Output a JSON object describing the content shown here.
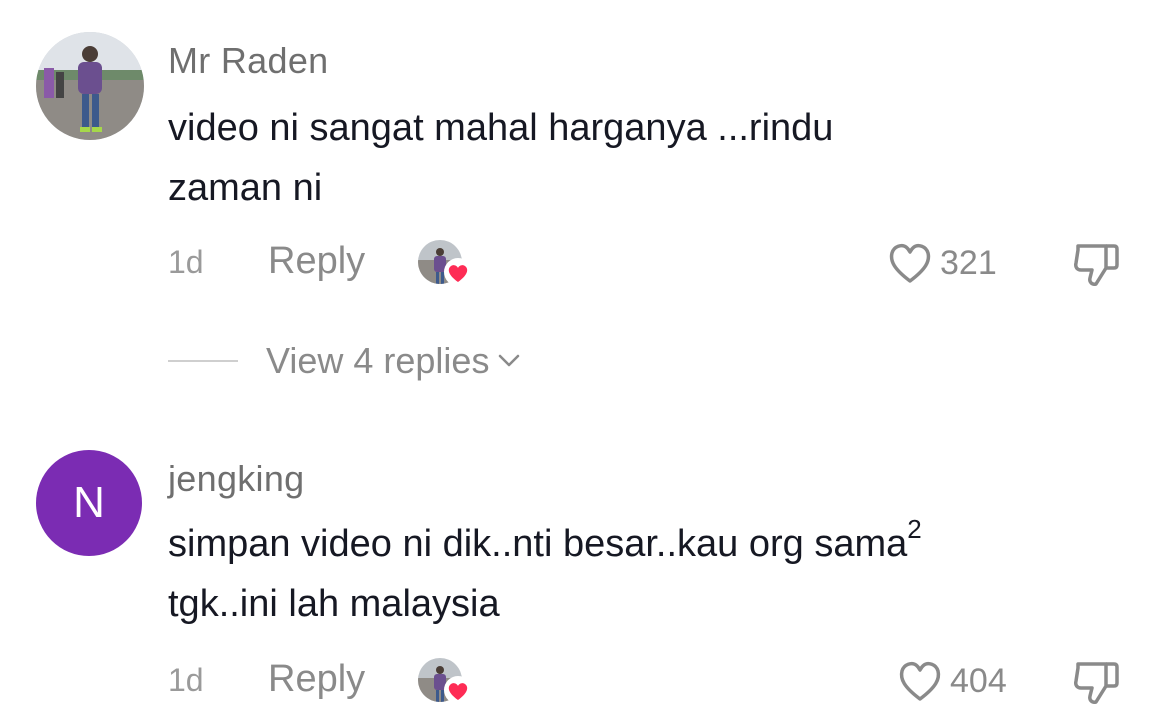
{
  "comments": [
    {
      "username": "Mr Raden",
      "text_line1": "video ni sangat mahal harganya ...rindu",
      "text_line2": "zaman ni",
      "age": "1d",
      "reply_label": "Reply",
      "likes": "321",
      "view_replies": "View 4 replies"
    },
    {
      "username": "jengking",
      "avatar_letter": "N",
      "text_line1_main": "simpan video ni dik..nti besar..kau org sama",
      "text_line1_sup": "2",
      "text_line2": "tgk..ini lah malaysia",
      "age": "1d",
      "reply_label": "Reply",
      "likes": "404"
    }
  ],
  "colors": {
    "avatar_purple": "#7b2cb3",
    "heart_badge": "#fe2c55",
    "muted_text": "#8a8a8a"
  },
  "icons": [
    "heart-outline-icon",
    "thumbs-down-icon",
    "chevron-down-icon",
    "creator-liked-heart-icon"
  ]
}
